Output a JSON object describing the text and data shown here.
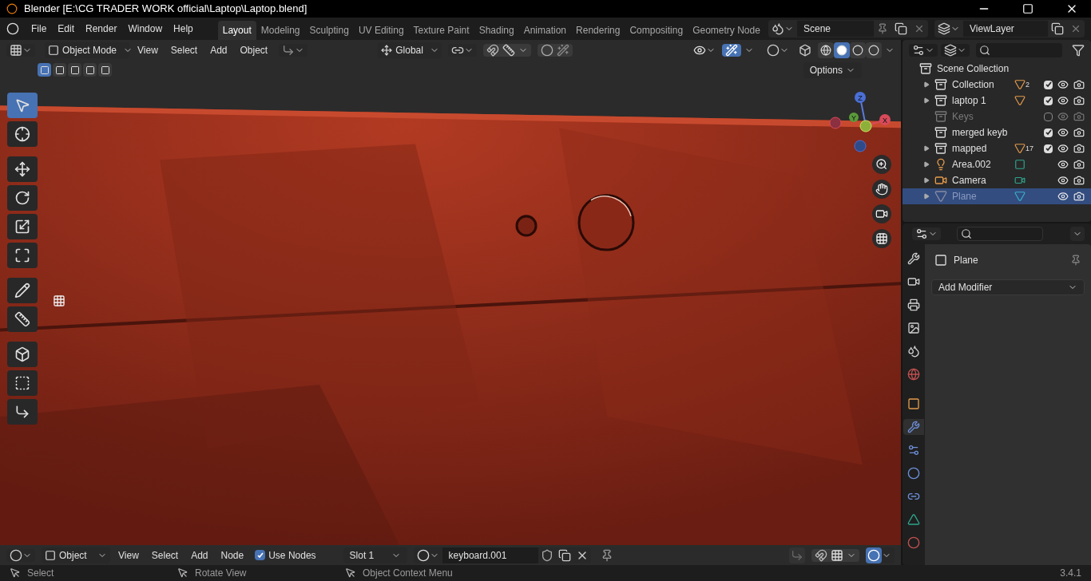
{
  "window": {
    "title": "Blender [E:\\CG TRADER WORK official\\Laptop\\Laptop.blend]"
  },
  "menu": [
    "File",
    "Edit",
    "Render",
    "Window",
    "Help"
  ],
  "workspaces": [
    {
      "label": "Layout",
      "selected": true
    },
    {
      "label": "Modeling",
      "selected": false
    },
    {
      "label": "Sculpting",
      "selected": false
    },
    {
      "label": "UV Editing",
      "selected": false
    },
    {
      "label": "Texture Paint",
      "selected": false
    },
    {
      "label": "Shading",
      "selected": false
    },
    {
      "label": "Animation",
      "selected": false
    },
    {
      "label": "Rendering",
      "selected": false
    },
    {
      "label": "Compositing",
      "selected": false
    },
    {
      "label": "Geometry Node",
      "selected": false
    }
  ],
  "scene": {
    "name": "Scene"
  },
  "view_layer": {
    "name": "ViewLayer"
  },
  "viewport_header": {
    "mode": "Object Mode",
    "menus": [
      "View",
      "Select",
      "Add",
      "Object"
    ],
    "orientation": "Global",
    "options": "Options"
  },
  "select_modes": [
    {
      "selected": true
    },
    {
      "selected": false
    },
    {
      "selected": false
    },
    {
      "selected": false
    },
    {
      "selected": false
    }
  ],
  "shading_modes": [
    {
      "selected": false
    },
    {
      "selected": true
    },
    {
      "selected": false
    },
    {
      "selected": false
    }
  ],
  "tools": [
    {
      "kind": "select",
      "selected": true
    },
    {
      "kind": "cursor",
      "selected": false
    },
    {
      "kind": "move",
      "selected": false
    },
    {
      "kind": "rotate",
      "selected": false
    },
    {
      "kind": "scale",
      "selected": false
    },
    {
      "kind": "transform",
      "selected": false
    },
    {
      "kind": "annotate",
      "selected": false
    },
    {
      "kind": "measure",
      "selected": false
    },
    {
      "kind": "add",
      "selected": false
    },
    {
      "kind": "shear",
      "selected": false
    },
    {
      "kind": "bend",
      "selected": false
    }
  ],
  "gizmo": {
    "axes": [
      "Z",
      "Y",
      "X"
    ]
  },
  "outliner": {
    "root": "Scene Collection",
    "items": [
      {
        "name": "Collection",
        "kind": "collection",
        "expandable": true,
        "checked": true,
        "badge": "2",
        "selected": false
      },
      {
        "name": "laptop 1",
        "kind": "collection",
        "expandable": true,
        "checked": true,
        "selected": false
      },
      {
        "name": "Keys",
        "kind": "collection",
        "expandable": false,
        "checked": false,
        "selected": false
      },
      {
        "name": "merged keyb",
        "kind": "collection",
        "expandable": false,
        "checked": true,
        "selected": false
      },
      {
        "name": "mapped",
        "kind": "collection",
        "expandable": true,
        "checked": true,
        "badge": "17",
        "selected": false
      },
      {
        "name": "Area.002",
        "kind": "light",
        "expandable": true,
        "selected": false
      },
      {
        "name": "Camera",
        "kind": "camera",
        "expandable": true,
        "selected": false
      },
      {
        "name": "Plane",
        "kind": "mesh",
        "expandable": true,
        "selected": true
      }
    ]
  },
  "properties": {
    "object_name": "Plane",
    "button": "Add Modifier",
    "tabs": [
      {
        "selected": false
      },
      {
        "selected": false
      },
      {
        "selected": false
      },
      {
        "selected": false
      },
      {
        "selected": false
      },
      {
        "selected": false
      },
      {
        "selected": false
      },
      {
        "selected": true
      },
      {
        "selected": false
      },
      {
        "selected": false
      },
      {
        "selected": false
      },
      {
        "selected": false
      },
      {
        "selected": false
      }
    ]
  },
  "shader_header": {
    "editor": "Object",
    "menus": [
      "View",
      "Select",
      "Add",
      "Node"
    ],
    "use_nodes": {
      "label": "Use Nodes",
      "checked": true
    },
    "slot": "Slot 1",
    "material": "keyboard.001"
  },
  "status_bar": {
    "hints": [
      "Select",
      "Rotate View",
      "Object Context Menu"
    ],
    "version": "3.4.1"
  }
}
